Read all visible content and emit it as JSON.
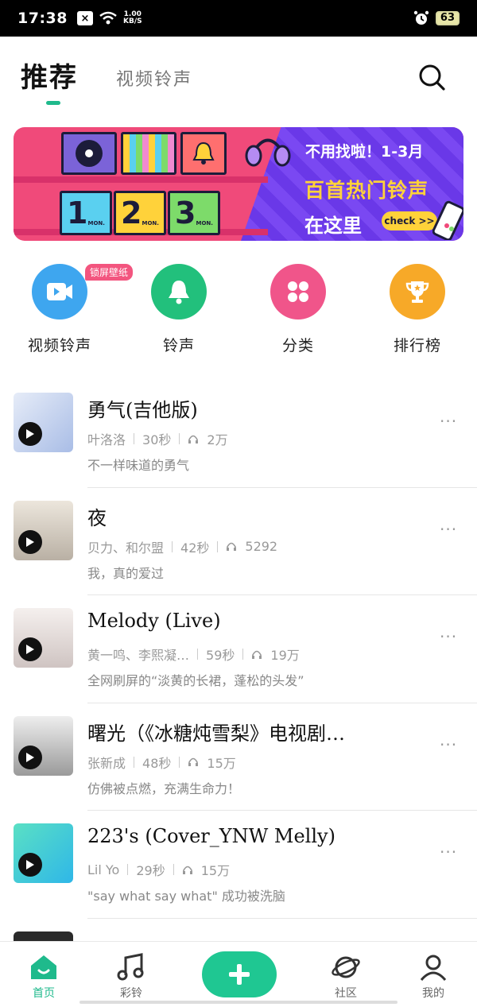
{
  "status_bar": {
    "time": "17:38",
    "speed_top": "1.00",
    "speed_bottom": "KB/S",
    "battery": "63"
  },
  "header": {
    "tab_active": "推荐",
    "tab_inactive": "视频铃声"
  },
  "banner": {
    "line1": "不用找啦！1-3月",
    "line2": "百首热门铃声",
    "line3": "在这里",
    "check": "check >>",
    "box_labels": [
      "1",
      "2",
      "3"
    ],
    "box_month": "MON."
  },
  "categories": [
    {
      "label": "视频铃声",
      "badge": "锁屏壁纸",
      "icon": "video-icon",
      "color": "#3ea6ef"
    },
    {
      "label": "铃声",
      "icon": "bell-icon",
      "color": "#22c07c"
    },
    {
      "label": "分类",
      "icon": "grid-icon",
      "color": "#f0558a"
    },
    {
      "label": "排行榜",
      "icon": "trophy-icon",
      "color": "#f7a928"
    }
  ],
  "songs": [
    {
      "title": "勇气(吉他版)",
      "artist": "叶洛洛",
      "duration": "30秒",
      "plays": "2万",
      "desc": "不一样味道的勇气",
      "thumb_color": "#c6d4ef"
    },
    {
      "title": "夜",
      "artist": "贝力、和尔盟",
      "duration": "42秒",
      "plays": "5292",
      "desc": "我，真的爱过",
      "thumb_color": "#d9d3c9"
    },
    {
      "title": "Melody (Live)",
      "artist": "黄一鸣、李熙凝…",
      "duration": "59秒",
      "plays": "19万",
      "desc": "全网刷屏的“淡黄的长裙，蓬松的头发”",
      "thumb_color": "#e9e2e0"
    },
    {
      "title": "曙光（《冰糖炖雪梨》电视剧…",
      "artist": "张新成",
      "duration": "48秒",
      "plays": "15万",
      "desc": "仿佛被点燃，充满生命力！",
      "thumb_color": "#d8d8d8"
    },
    {
      "title": "223's (Cover_YNW Melly)",
      "artist": "Lil Yo",
      "duration": "29秒",
      "plays": "15万",
      "desc": "\"say what say what\" 成功被洗脑",
      "thumb_color": "#3ad6b4"
    }
  ],
  "bottom_nav": {
    "home": "首页",
    "ringtone": "彩铃",
    "community": "社区",
    "mine": "我的"
  },
  "colors": {
    "accent": "#1fba8c",
    "plus": "#1fc792"
  }
}
